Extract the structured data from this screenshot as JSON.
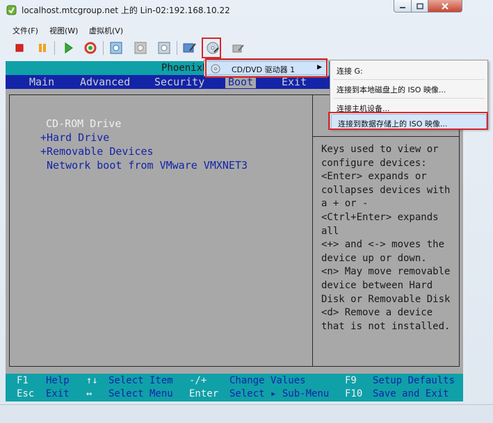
{
  "window": {
    "title": "localhost.mtcgroup.net 上的 Lin-02:192.168.10.22"
  },
  "menubar": {
    "items": [
      "文件(F)",
      "视图(W)",
      "虚拟机(V)"
    ]
  },
  "toolbar": {
    "icons": [
      "stop-icon",
      "pause-icon",
      "play-icon",
      "reset-icon",
      "snapshot-icon",
      "revert-snapshot-icon",
      "manage-snapshot-icon",
      "edit-settings-icon",
      "cd-dvd-icon",
      "floppy-icon"
    ]
  },
  "bios": {
    "title": "PhoenixBIOS Setup Utility",
    "tabs": [
      "Main",
      "Advanced",
      "Security",
      "Boot",
      "Exit"
    ],
    "active_tab": "Boot",
    "boot_items": [
      "CD-ROM Drive",
      "+Hard Drive",
      "+Removable Devices",
      " Network boot from VMware VMXNET3"
    ],
    "help_lines": [
      "Keys used to view or",
      "configure devices:",
      "<Enter> expands or",
      "collapses devices with",
      "a + or -",
      "<Ctrl+Enter> expands",
      "all",
      "<+> and <-> moves the",
      "device up or down.",
      "<n> May move removable",
      "device between Hard",
      "Disk or Removable Disk",
      "<d> Remove a device",
      "that is not installed."
    ],
    "footer": [
      {
        "key": "F1",
        "desc": "Help"
      },
      {
        "key": "↑↓",
        "desc": "Select Item"
      },
      {
        "key": "-/+",
        "desc": "Change Values"
      },
      {
        "key": "F9",
        "desc": "Setup Defaults"
      },
      {
        "key": "Esc",
        "desc": "Exit"
      },
      {
        "key": "↔",
        "desc": "Select Menu"
      },
      {
        "key": "Enter",
        "desc": "Select ▸ Sub-Menu"
      },
      {
        "key": "F10",
        "desc": "Save and Exit"
      }
    ]
  },
  "context_menu": {
    "item": "CD/DVD 驱动器 1",
    "submenu": [
      "连接 G:",
      "连接到本地磁盘上的 ISO 映像...",
      "连接主机设备...",
      "连接到数据存储上的 ISO 映像..."
    ]
  },
  "colors": {
    "bios_cyan": "#10a0a8",
    "bios_blue": "#1424a8",
    "bios_gray": "#a8a8a8",
    "highlight_red": "#d9262a"
  }
}
